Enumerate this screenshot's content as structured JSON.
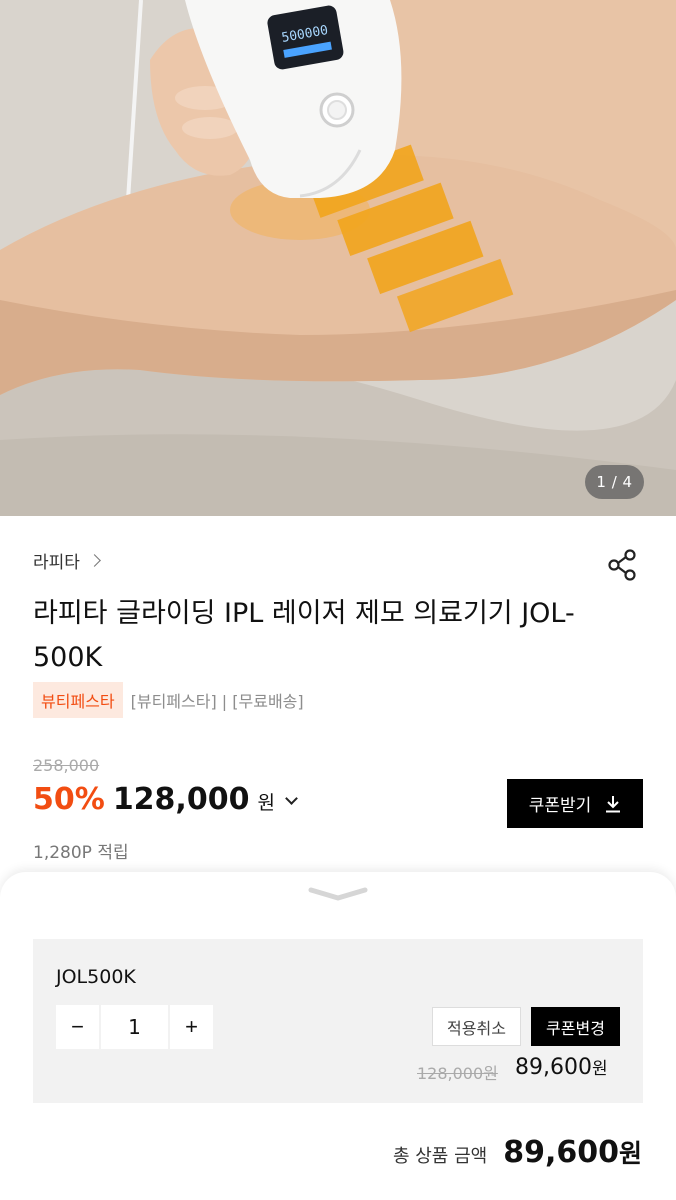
{
  "gallery": {
    "counter": "1 / 4"
  },
  "product": {
    "brand": "라피타",
    "title": "라피타 글라이딩 IPL 레이저 제모 의료기기 JOL-500K",
    "device_display": "500000",
    "tag_badge": "뷰티페스타",
    "tag_text": "[뷰티페스타] | [무료배송]",
    "original_price": "258,000",
    "discount": "50%",
    "price": "128,000",
    "price_unit": "원",
    "points": "1,280P 적립",
    "coupon_button": "쿠폰받기"
  },
  "sheet": {
    "option_name": "JOL500K",
    "quantity": "1",
    "minus": "−",
    "plus": "+",
    "cancel_label": "적용취소",
    "change_label": "쿠폰변경",
    "option_original_price": "128,000원",
    "option_price": "89,600",
    "option_price_unit": "원",
    "total_label": "총 상품 금액",
    "total_value": "89,600",
    "total_unit": "원"
  },
  "colors": {
    "accent": "#f24d12",
    "badge_bg": "#fde9df",
    "button": "#000000"
  },
  "icons": [
    "share-icon",
    "chevron-right-icon",
    "chevron-down-icon",
    "download-icon",
    "sheet-handle-icon"
  ]
}
